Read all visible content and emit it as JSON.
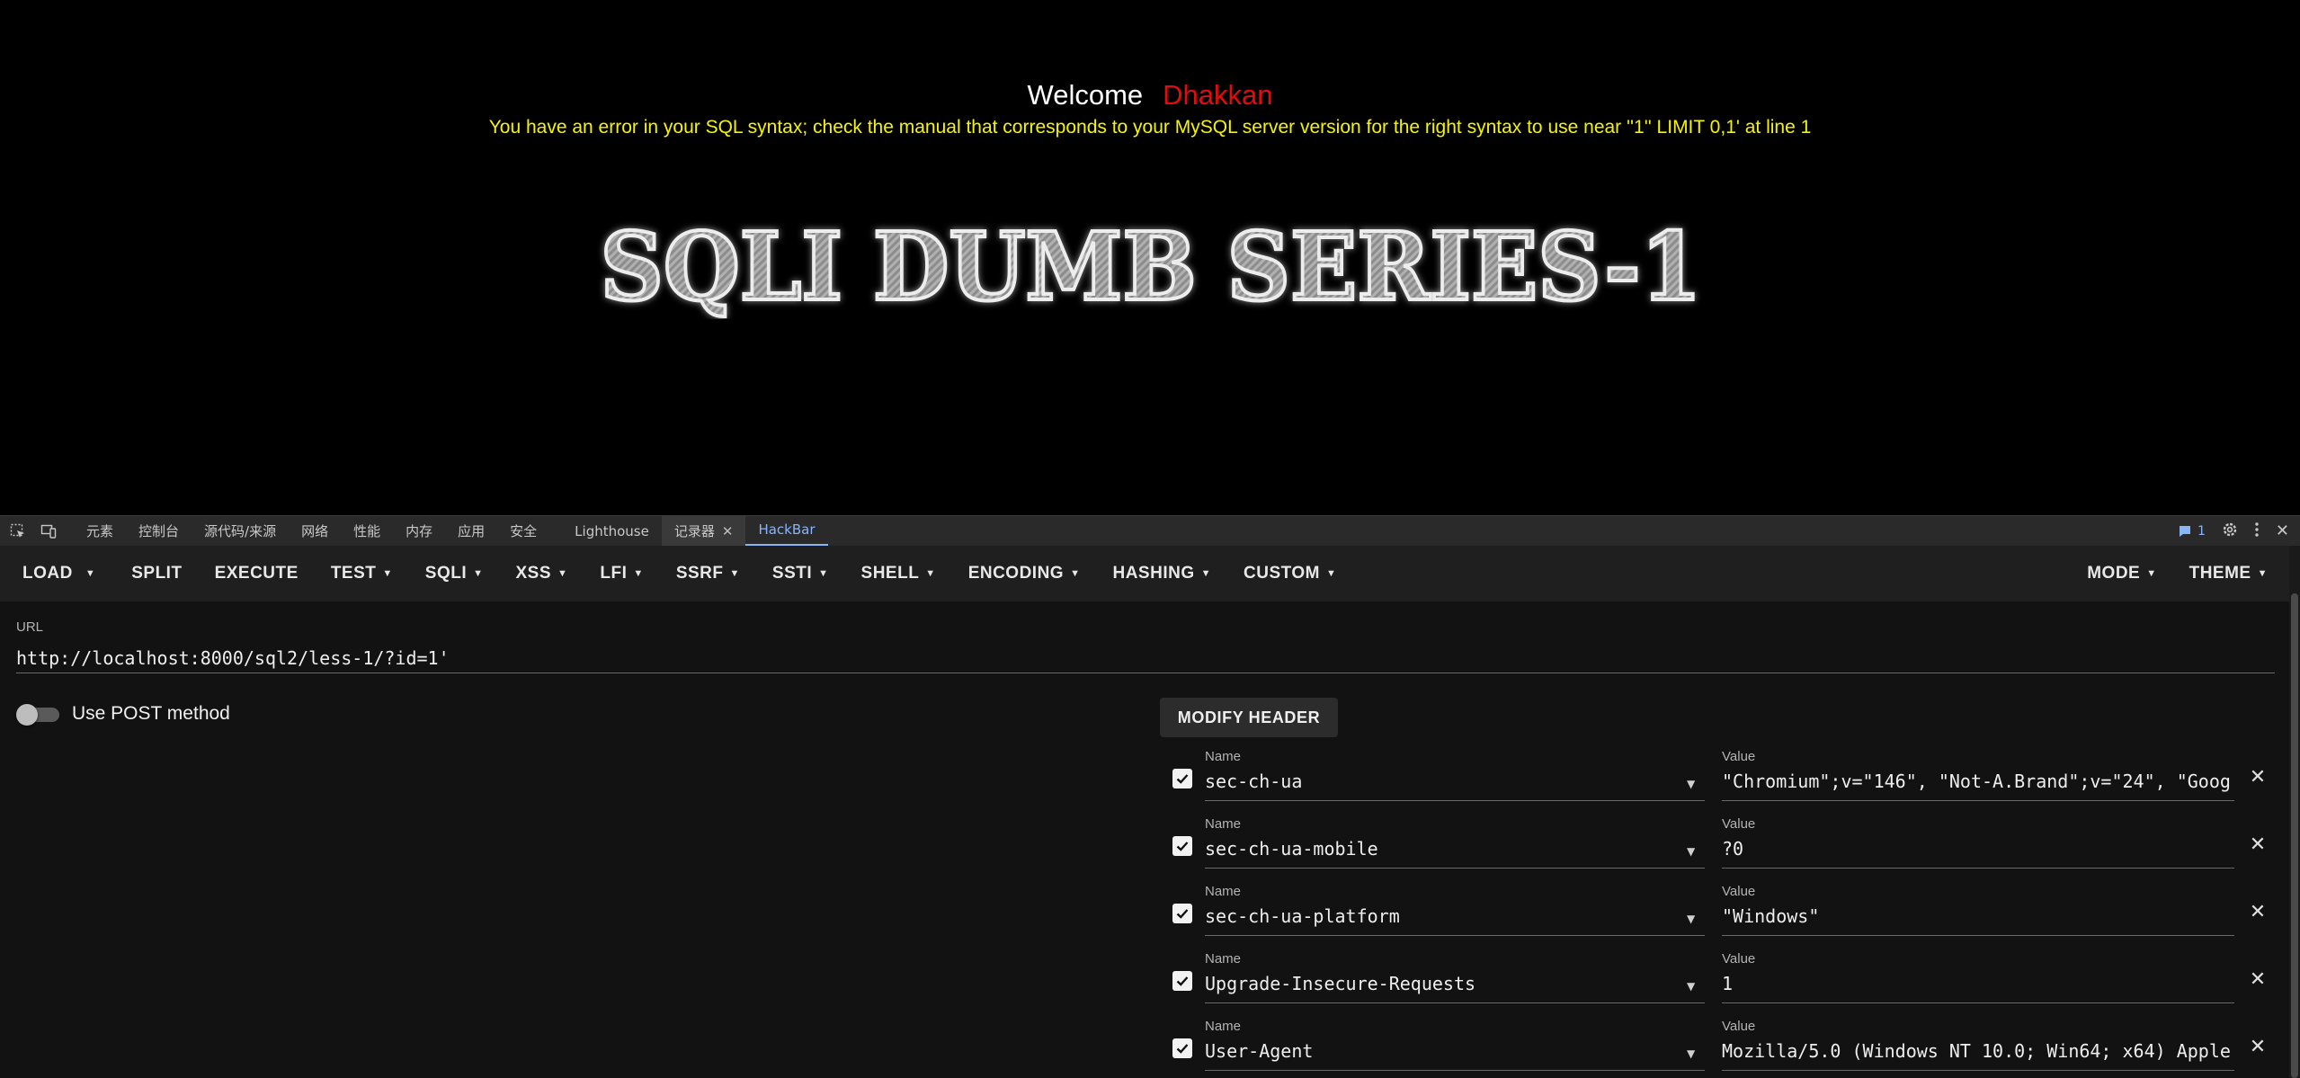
{
  "page": {
    "welcome_label": "Welcome",
    "user_name": "Dhakkan",
    "sql_error": "You have an error in your SQL syntax; check the manual that corresponds to your MySQL server version for the right syntax to use near ''1'' LIMIT 0,1' at line 1",
    "banner_text": "SQLI DUMB SERIES-1"
  },
  "devtools": {
    "tabs": [
      "元素",
      "控制台",
      "源代码/来源",
      "网络",
      "性能",
      "内存",
      "应用",
      "安全",
      "Lighthouse",
      "记录器",
      "HackBar"
    ],
    "issues_count": "1",
    "accent": "#8ab4f8"
  },
  "toolbar": {
    "load": "LOAD",
    "items": [
      "SPLIT",
      "EXECUTE",
      "TEST",
      "SQLI",
      "XSS",
      "LFI",
      "SSRF",
      "SSTI",
      "SHELL",
      "ENCODING",
      "HASHING",
      "CUSTOM"
    ],
    "right_items": [
      "MODE",
      "THEME"
    ]
  },
  "url": {
    "label": "URL",
    "value": "http://localhost:8000/sql2/less-1/?id=1'"
  },
  "post": {
    "label": "Use POST method",
    "enabled": false
  },
  "headers": {
    "button_label": "MODIFY HEADER",
    "name_label": "Name",
    "value_label": "Value",
    "rows": [
      {
        "name": "sec-ch-ua",
        "value": "\"Chromium\";v=\"146\", \"Not-A.Brand\";v=\"24\", \"Goog"
      },
      {
        "name": "sec-ch-ua-mobile",
        "value": "?0"
      },
      {
        "name": "sec-ch-ua-platform",
        "value": "\"Windows\""
      },
      {
        "name": "Upgrade-Insecure-Requests",
        "value": "1"
      },
      {
        "name": "User-Agent",
        "value": "Mozilla/5.0 (Windows NT 10.0; Win64; x64) Apple"
      }
    ]
  },
  "colors": {
    "welcome": "#ffffff",
    "user_name": "#e00d0d",
    "sql_error": "#f5f20c"
  }
}
